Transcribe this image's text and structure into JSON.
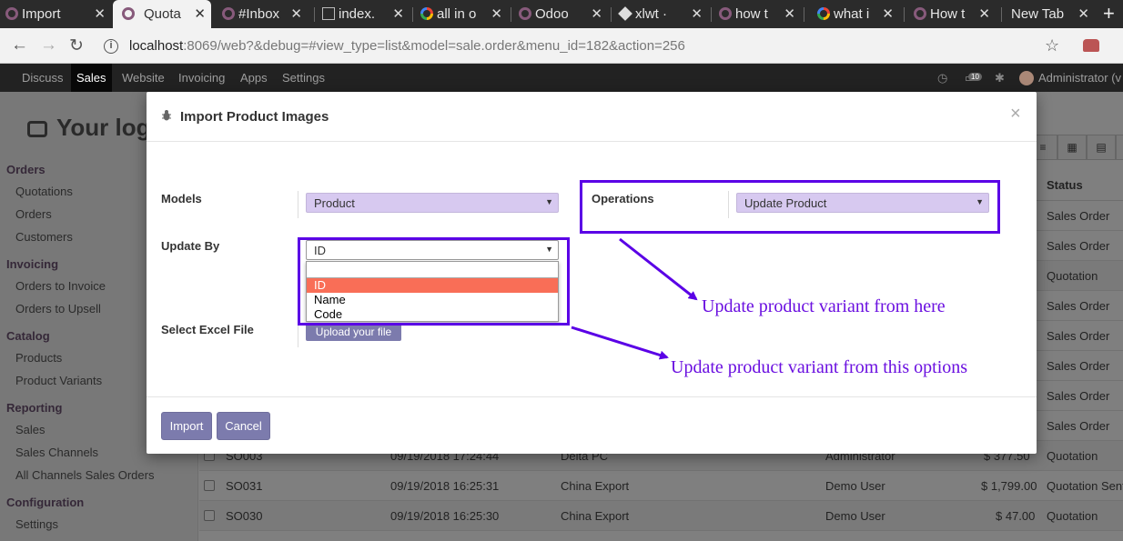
{
  "browser": {
    "tabs": [
      {
        "label": "Import",
        "icon": "odoo-icon",
        "active": false
      },
      {
        "label": "Quota",
        "icon": "odoo-icon",
        "active": true
      },
      {
        "label": "#Inbox",
        "icon": "odoo-icon",
        "active": false
      },
      {
        "label": "index.",
        "icon": "document-icon",
        "active": false
      },
      {
        "label": "all in o",
        "icon": "google-icon",
        "active": false
      },
      {
        "label": "Odoo",
        "icon": "odoo-icon",
        "active": false
      },
      {
        "label": "xlwt ·",
        "icon": "package-icon",
        "active": false
      },
      {
        "label": "how t",
        "icon": "odoo-icon",
        "active": false
      },
      {
        "label": "what i",
        "icon": "google-icon",
        "active": false
      },
      {
        "label": "How t",
        "icon": "odoo-icon",
        "active": false
      },
      {
        "label": "New Tab",
        "icon": "",
        "active": false
      }
    ],
    "url_host": "localhost",
    "url_rest": ":8069/web?&debug=#view_type=list&model=sale.order&menu_id=182&action=256"
  },
  "topnav": {
    "items": [
      "Discuss",
      "Sales",
      "Website",
      "Invoicing",
      "Apps",
      "Settings"
    ],
    "active": "Sales",
    "chat_count": "10",
    "user": "Administrator (v"
  },
  "sidebar": {
    "logo_text": "Your log",
    "sections": [
      {
        "title": "Orders",
        "items": [
          "Quotations",
          "Orders",
          "Customers"
        ]
      },
      {
        "title": "Invoicing",
        "items": [
          "Orders to Invoice",
          "Orders to Upsell"
        ]
      },
      {
        "title": "Catalog",
        "items": [
          "Products",
          "Product Variants"
        ]
      },
      {
        "title": "Reporting",
        "items": [
          "Sales",
          "Sales Channels",
          "All Channels Sales Orders"
        ]
      },
      {
        "title": "Configuration",
        "items": [
          "Settings"
        ]
      }
    ]
  },
  "list": {
    "status_header": "Status",
    "status_only_rows": [
      "Sales Order",
      "Sales Order",
      "Quotation",
      "Sales Order",
      "Sales Order",
      "Sales Order",
      "Sales Order",
      "Sales Order"
    ],
    "rows": [
      {
        "number": "SO003",
        "date": "09/19/2018 17:24:44",
        "customer": "Delta PC",
        "salesperson": "Administrator",
        "total": "$ 377.50",
        "status": "Quotation"
      },
      {
        "number": "SO031",
        "date": "09/19/2018 16:25:31",
        "customer": "China Export",
        "salesperson": "Demo User",
        "total": "$ 1,799.00",
        "status": "Quotation Sent"
      },
      {
        "number": "SO030",
        "date": "09/19/2018 16:25:30",
        "customer": "China Export",
        "salesperson": "Demo User",
        "total": "$ 47.00",
        "status": "Quotation"
      }
    ]
  },
  "modal": {
    "title": "Import Product Images",
    "models_label": "Models",
    "models_value": "Product",
    "operations_label": "Operations",
    "operations_value": "Update Product",
    "update_by_label": "Update By",
    "update_by_value": "ID",
    "update_by_options": [
      "ID",
      "Name",
      "Code"
    ],
    "select_file_label": "Select Excel File",
    "upload_label": "Upload your file",
    "import_label": "Import",
    "cancel_label": "Cancel"
  },
  "annotations": {
    "note1": "Update product variant from here",
    "note2": "Update product variant from this options",
    "color": "#5a00e6"
  }
}
